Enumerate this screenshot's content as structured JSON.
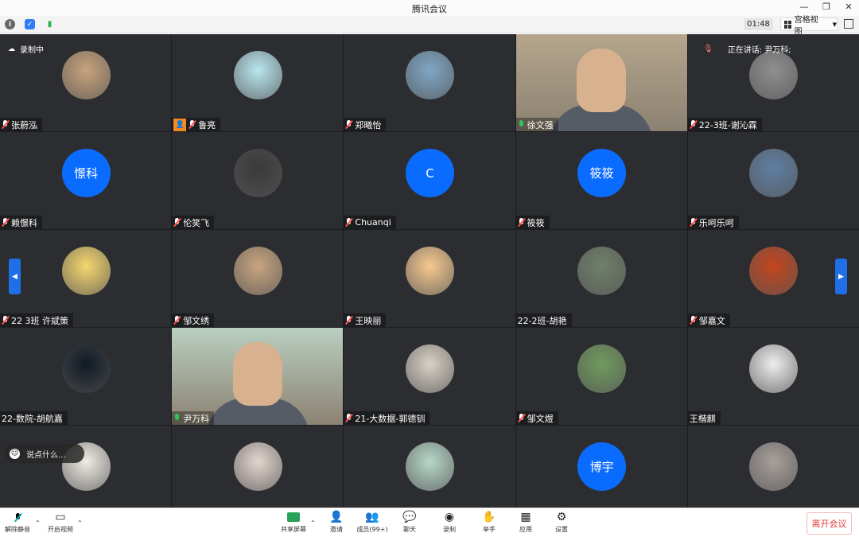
{
  "window": {
    "title": "腾讯会议",
    "controls": [
      "—",
      "❐",
      "✕"
    ]
  },
  "infobar": {
    "timer": "01:48",
    "view_label": "宫格视图",
    "recording_label": "录制中",
    "speaking_label": "正在讲话: 尹万科;"
  },
  "participants": [
    {
      "name": "张蔚泓",
      "mic": "muted",
      "avatar": "photo",
      "color": "#c9a37c"
    },
    {
      "name": "鲁亮",
      "mic": "muted",
      "avatar": "photo",
      "color": "#b9e6f0",
      "host": true
    },
    {
      "name": "郑曦怡",
      "mic": "muted",
      "avatar": "photo",
      "color": "#7fa7c6"
    },
    {
      "name": "徐文强",
      "mic": "on",
      "avatar": "video",
      "color": "#b5a58c"
    },
    {
      "name": "22-3班-谢沁霖",
      "mic": "muted",
      "avatar": "photo",
      "color": "#8f8f8f"
    },
    {
      "name": "赖憬科",
      "mic": "muted",
      "avatar": "text",
      "avatar_text": "憬科"
    },
    {
      "name": "伦笑飞",
      "mic": "muted",
      "avatar": "photo",
      "color": "#3a3a3a"
    },
    {
      "name": "Chuanqi",
      "mic": "muted",
      "avatar": "text",
      "avatar_text": "C"
    },
    {
      "name": "筱筱",
      "mic": "muted",
      "avatar": "text",
      "avatar_text": "筱筱"
    },
    {
      "name": "乐呵乐呵",
      "mic": "muted",
      "avatar": "photo",
      "color": "#5f7fa3"
    },
    {
      "name": "22 3班 许斌策",
      "mic": "muted",
      "avatar": "photo",
      "color": "#f5d76e"
    },
    {
      "name": "邹文绣",
      "mic": "muted",
      "avatar": "photo",
      "color": "#c9a57f"
    },
    {
      "name": "王映丽",
      "mic": "muted",
      "avatar": "photo",
      "color": "#f7c98f"
    },
    {
      "name": "22-2班-胡艳",
      "mic": "none",
      "avatar": "photo",
      "color": "#6f7f6a"
    },
    {
      "name": "邹嘉文",
      "mic": "muted",
      "avatar": "photo",
      "color": "#c4451d"
    },
    {
      "name": "22-数院-胡航嘉",
      "mic": "none",
      "avatar": "photo",
      "color": "#111a24"
    },
    {
      "name": "尹万科",
      "mic": "on",
      "avatar": "video",
      "color": "#b9cfc0"
    },
    {
      "name": "21-大数据-郭德钏",
      "mic": "muted",
      "avatar": "photo",
      "color": "#d9d2c6"
    },
    {
      "name": "邹文煜",
      "mic": "muted",
      "avatar": "photo",
      "color": "#6f9a5e"
    },
    {
      "name": "王楷麒",
      "mic": "none",
      "avatar": "photo",
      "color": "#eeeeee"
    },
    {
      "name": "",
      "mic": "none",
      "avatar": "photo",
      "color": "#f0ece4"
    },
    {
      "name": "",
      "mic": "none",
      "avatar": "photo",
      "color": "#e4d6cf"
    },
    {
      "name": "",
      "mic": "none",
      "avatar": "photo",
      "color": "#b6d7c9"
    },
    {
      "name": "",
      "mic": "none",
      "avatar": "text",
      "avatar_text": "博宇"
    },
    {
      "name": "",
      "mic": "none",
      "avatar": "photo",
      "color": "#a79f9a"
    }
  ],
  "chat_hint": "说点什么...",
  "toolbar": {
    "unmute": "解除静音",
    "start_video": "开启视频",
    "share": "共享屏幕",
    "invite": "邀请",
    "members": "成员(99+)",
    "chat": "聊天",
    "record": "录制",
    "raise_hand": "举手",
    "apps": "应用",
    "settings": "设置",
    "leave": "离开会议"
  },
  "colors": {
    "accent_blue": "#0a6cff",
    "grid_bg": "#2c2d31",
    "leave_red": "#e33b3b"
  }
}
